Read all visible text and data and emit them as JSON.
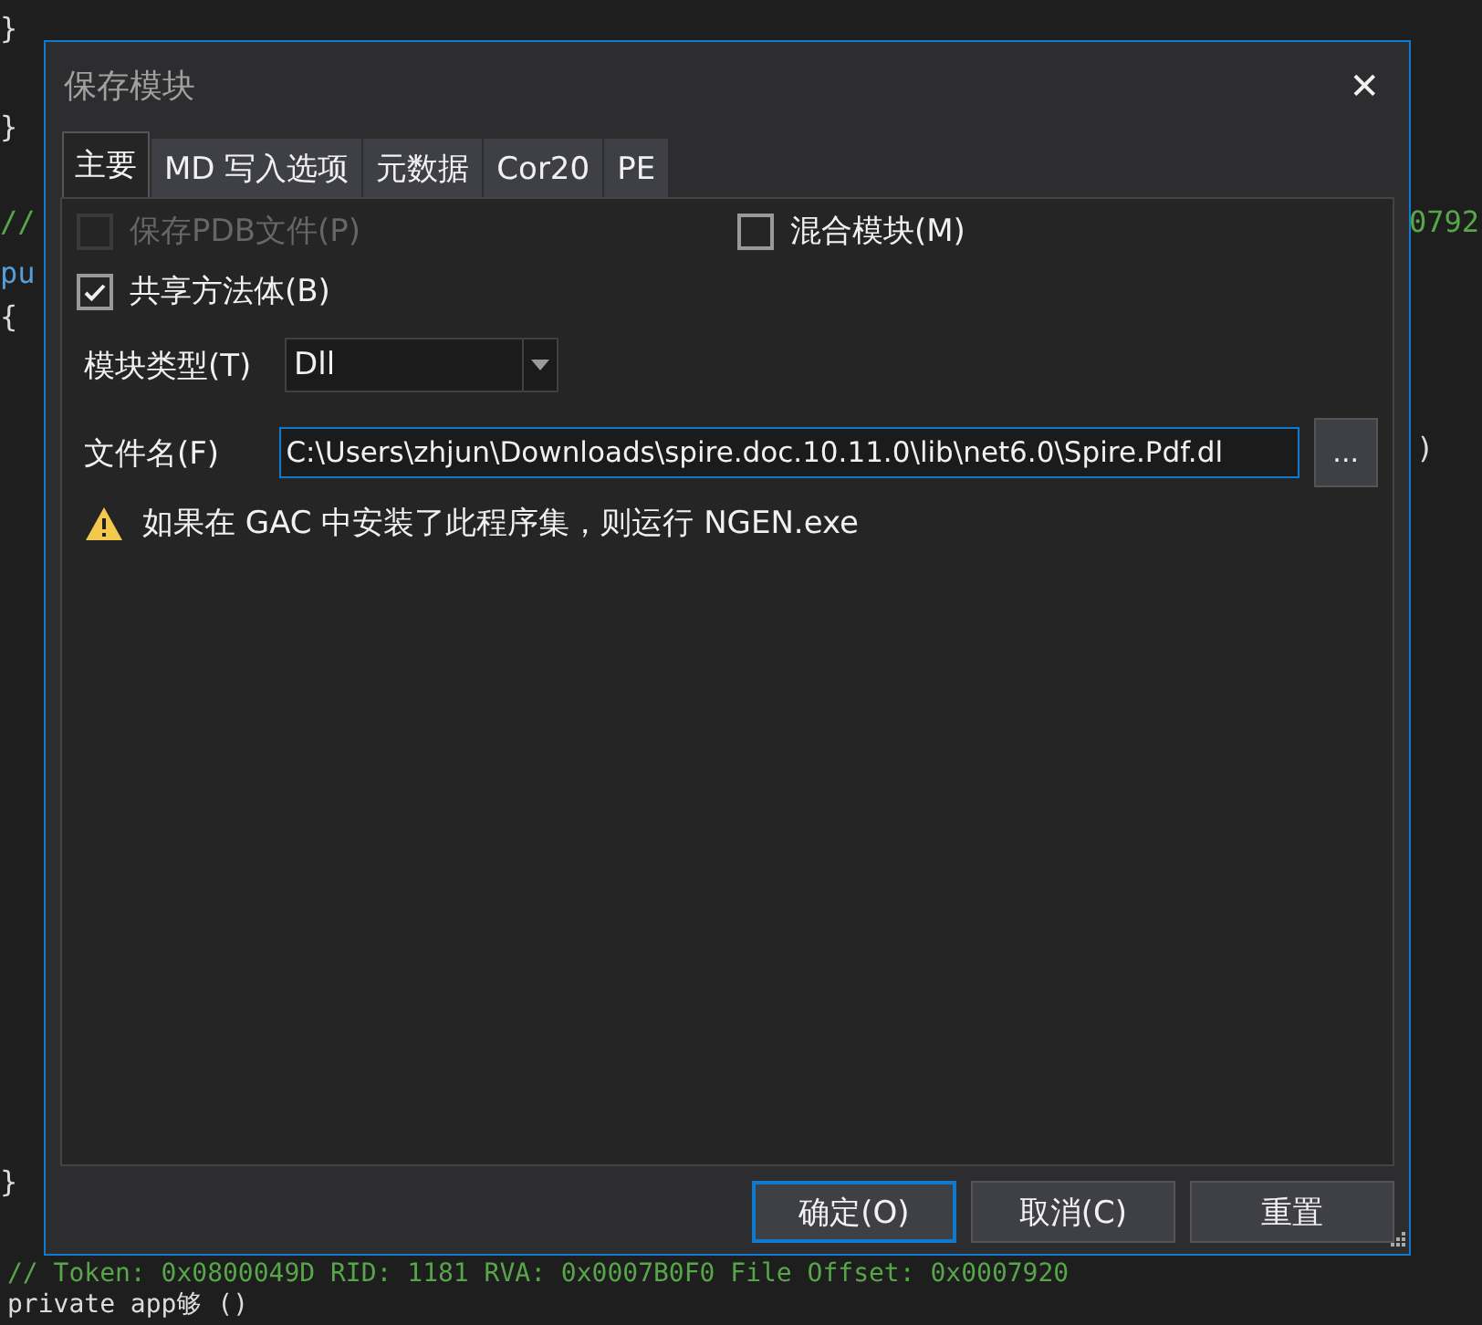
{
  "editor": {
    "fragments": [
      {
        "text": "}",
        "kind": "left"
      },
      {
        "text": "}",
        "kind": "left"
      },
      {
        "text": "//",
        "kind": "comment"
      },
      {
        "text": "0792",
        "kind": "comment"
      },
      {
        "text": "pu",
        "kind": "keyword"
      },
      {
        "text": "{",
        "kind": "left"
      },
      {
        "text": ")",
        "kind": "left"
      },
      {
        "text": "}",
        "kind": "left"
      }
    ],
    "bottom_lines": [
      {
        "text": "// Token: 0x0800049D RID: 1181 RVA: 0x0007B0F0 File Offset: 0x0007920",
        "kind": "comment"
      },
      {
        "text": "private app够 ()",
        "kind": "code"
      }
    ]
  },
  "dialog": {
    "title": "保存模块",
    "close": "✕",
    "tabs": [
      {
        "label": "主要",
        "selected": true
      },
      {
        "label": "MD 写入选项",
        "selected": false
      },
      {
        "label": "元数据",
        "selected": false
      },
      {
        "label": "Cor20",
        "selected": false
      },
      {
        "label": "PE",
        "selected": false
      }
    ],
    "checkboxes": [
      {
        "label": "保存PDB文件(P)",
        "checked": false,
        "disabled": true
      },
      {
        "label": "混合模块(M)",
        "checked": false,
        "disabled": false
      },
      {
        "label": "共享方法体(B)",
        "checked": true,
        "disabled": false
      }
    ],
    "module_type": {
      "label": "模块类型(T)",
      "value": "Dll"
    },
    "file_name": {
      "label": "文件名(F)",
      "value": "C:\\Users\\zhjun\\Downloads\\spire.doc.10.11.0\\lib\\net6.0\\Spire.Pdf.dl",
      "browse": "..."
    },
    "warning": "如果在 GAC 中安装了此程序集，则运行 NGEN.exe",
    "buttons": [
      {
        "label": "确定(O)",
        "selected": true
      },
      {
        "label": "取消(C)",
        "selected": false
      },
      {
        "label": "重置",
        "selected": false
      }
    ]
  }
}
